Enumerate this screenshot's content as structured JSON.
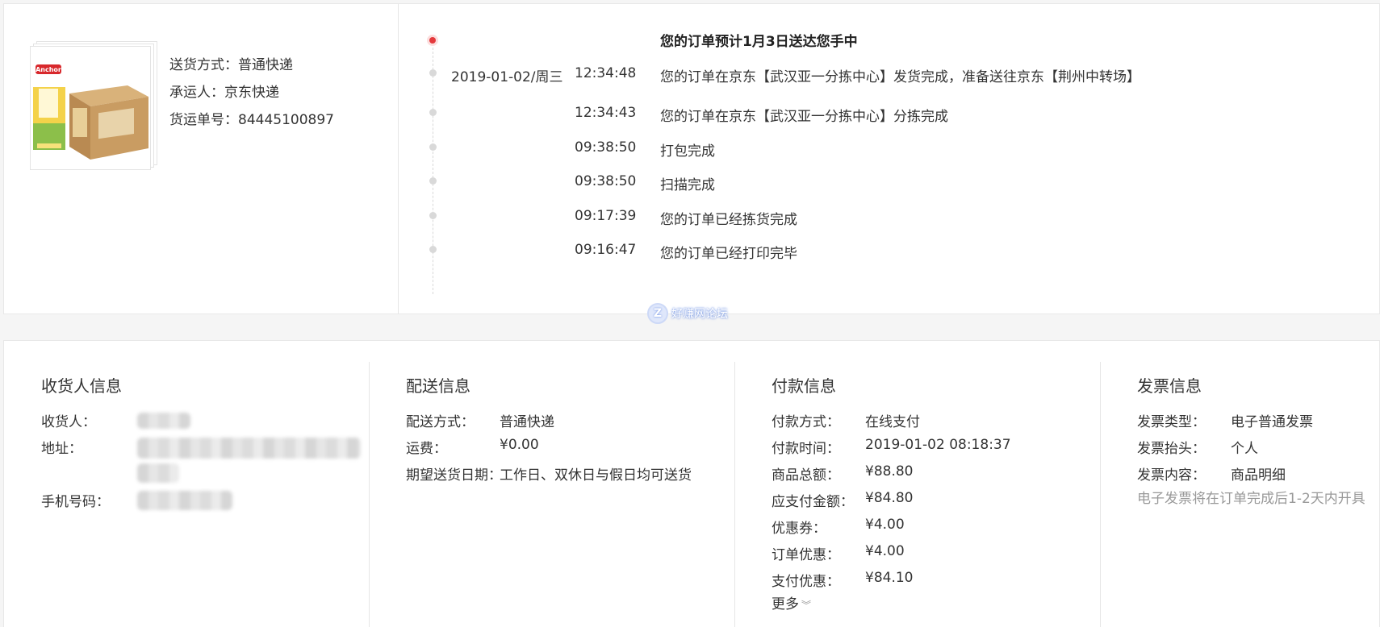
{
  "shipment": {
    "product_image_alt": "Anchor 牛奶",
    "method_label": "送货方式：",
    "method_value": "普通快递",
    "carrier_label": "承运人：",
    "carrier_value": "京东快递",
    "tracking_label": "货运单号：",
    "tracking_value": "84445100897"
  },
  "timeline": {
    "headline": "您的订单预计1月3日送达您手中",
    "events": [
      {
        "date": "2019-01-02/周三",
        "time": "12:34:48",
        "text": "您的订单在京东【武汉亚一分拣中心】发货完成，准备送往京东【荆州中转场】"
      },
      {
        "date": "",
        "time": "12:34:43",
        "text": "您的订单在京东【武汉亚一分拣中心】分拣完成"
      },
      {
        "date": "",
        "time": "09:38:50",
        "text": "打包完成"
      },
      {
        "date": "",
        "time": "09:38:50",
        "text": "扫描完成"
      },
      {
        "date": "",
        "time": "09:17:39",
        "text": "您的订单已经拣货完成"
      },
      {
        "date": "",
        "time": "09:16:47",
        "text": "您的订单已经打印完毕"
      }
    ]
  },
  "watermark": {
    "icon": "Z",
    "text": "好赚网论坛"
  },
  "receiver": {
    "title": "收货人信息",
    "name_label": "收货人：",
    "address_label": "地址：",
    "phone_label": "手机号码："
  },
  "delivery": {
    "title": "配送信息",
    "method_label": "配送方式：",
    "method_value": "普通快递",
    "fee_label": "运费：",
    "fee_value": "¥0.00",
    "date_label": "期望送货日期：",
    "date_value": "工作日、双休日与假日均可送货"
  },
  "payment": {
    "title": "付款信息",
    "rows": [
      {
        "label": "付款方式：",
        "value": "在线支付"
      },
      {
        "label": "付款时间：",
        "value": "2019-01-02 08:18:37"
      },
      {
        "label": "商品总额：",
        "value": "¥88.80"
      },
      {
        "label": "应支付金额：",
        "value": "¥84.80"
      },
      {
        "label": "优惠券：",
        "value": "¥4.00"
      },
      {
        "label": "订单优惠：",
        "value": "¥4.00"
      },
      {
        "label": "支付优惠：",
        "value": "¥84.10"
      }
    ],
    "more_label": "更多",
    "more_icon": "chevron-down-double"
  },
  "invoice": {
    "title": "发票信息",
    "type_label": "发票类型：",
    "type_value": "电子普通发票",
    "header_label": "发票抬头：",
    "header_value": "个人",
    "content_label": "发票内容：",
    "content_value": "商品明细",
    "note": "电子发票将在订单完成后1-2天内开具"
  },
  "colors": {
    "accent": "#e4393c",
    "muted": "#999999",
    "border": "#e6e6e6"
  }
}
